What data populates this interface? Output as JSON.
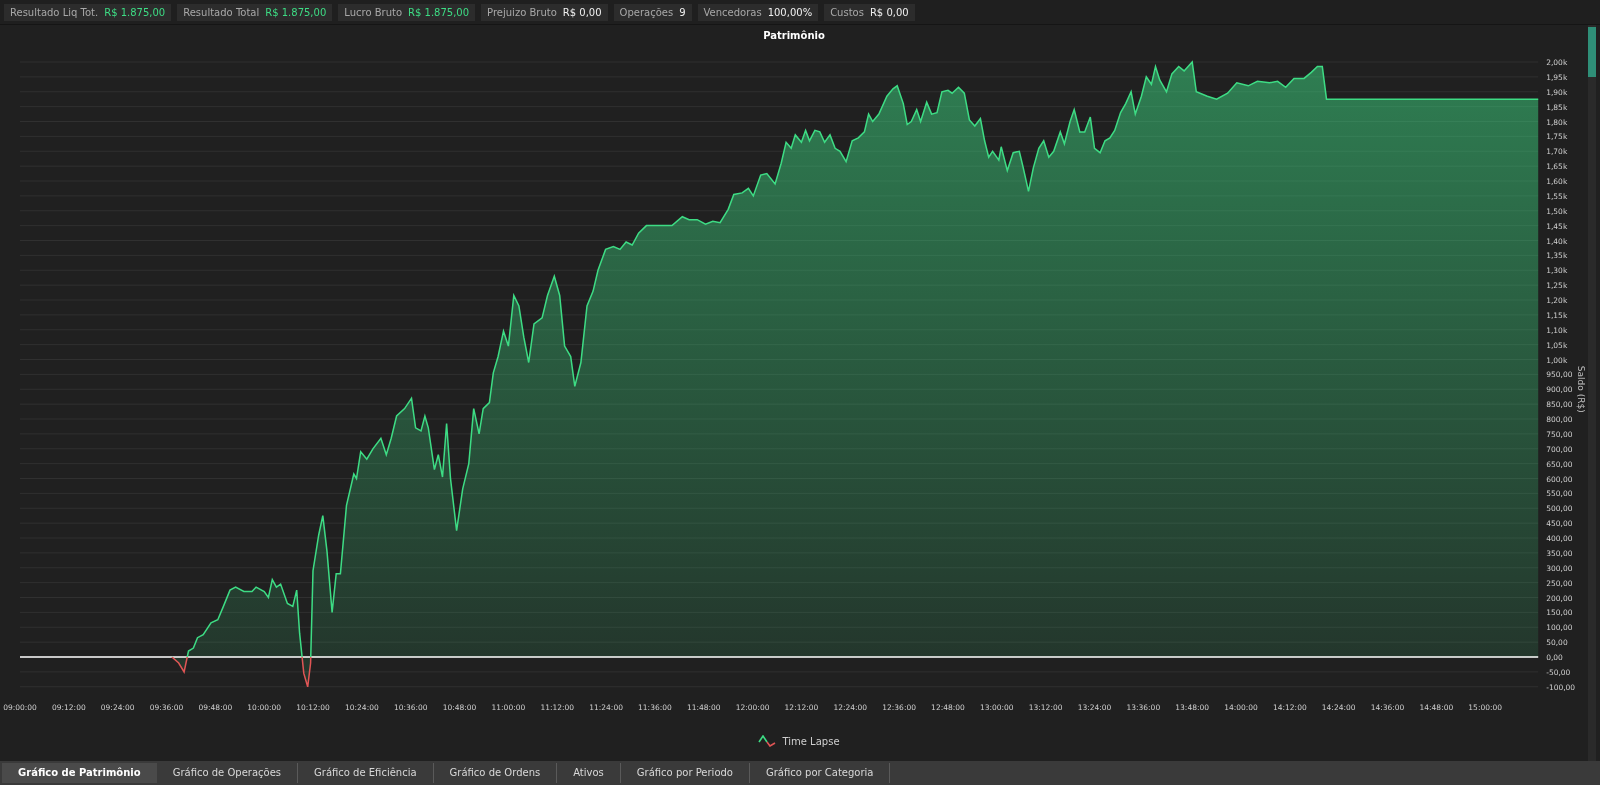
{
  "stats": [
    {
      "label": "Resultado Liq Tot.",
      "value": "R$ 1.875,00",
      "highlight": true
    },
    {
      "label": "Resultado Total",
      "value": "R$ 1.875,00",
      "highlight": true
    },
    {
      "label": "Lucro Bruto",
      "value": "R$ 1.875,00",
      "highlight": true
    },
    {
      "label": "Prejuizo Bruto",
      "value": "R$ 0,00",
      "highlight": false
    },
    {
      "label": "Operações",
      "value": "9",
      "highlight": false
    },
    {
      "label": "Vencedoras",
      "value": "100,00%",
      "highlight": false
    },
    {
      "label": "Custos",
      "value": "R$ 0,00",
      "highlight": false
    }
  ],
  "chart": {
    "chart_data": {
      "type": "area",
      "title": "Patrimônio",
      "ylabel": "Saldo (R$)",
      "x": [
        9.622,
        9.65,
        9.672,
        9.69,
        9.71,
        9.727,
        9.75,
        9.782,
        9.81,
        9.833,
        9.86,
        9.883,
        9.917,
        9.95,
        9.967,
        10,
        10.017,
        10.033,
        10.05,
        10.067,
        10.095,
        10.117,
        10.133,
        10.145,
        10.162,
        10.178,
        10.19,
        10.2,
        10.223,
        10.24,
        10.257,
        10.278,
        10.295,
        10.312,
        10.337,
        10.367,
        10.378,
        10.395,
        10.42,
        10.445,
        10.478,
        10.5,
        10.52,
        10.542,
        10.575,
        10.603,
        10.62,
        10.642,
        10.658,
        10.672,
        10.697,
        10.713,
        10.73,
        10.747,
        10.763,
        10.788,
        10.813,
        10.838,
        10.858,
        10.88,
        10.897,
        10.922,
        10.938,
        10.958,
        10.98,
        11,
        11.022,
        11.043,
        11.063,
        11.083,
        11.105,
        11.138,
        11.16,
        11.188,
        11.21,
        11.23,
        11.255,
        11.272,
        11.297,
        11.322,
        11.347,
        11.367,
        11.398,
        11.43,
        11.457,
        11.482,
        11.507,
        11.533,
        11.565,
        11.607,
        11.67,
        11.712,
        11.74,
        11.773,
        11.807,
        11.837,
        11.867,
        11.9,
        11.923,
        11.957,
        11.983,
        12.003,
        12.033,
        12.058,
        12.092,
        12.117,
        12.137,
        12.158,
        12.175,
        12.2,
        12.217,
        12.233,
        12.255,
        12.275,
        12.295,
        12.317,
        12.338,
        12.358,
        12.383,
        12.408,
        12.433,
        12.458,
        12.475,
        12.492,
        12.517,
        12.55,
        12.575,
        12.592,
        12.617,
        12.633,
        12.65,
        12.672,
        12.688,
        12.713,
        12.733,
        12.755,
        12.775,
        12.8,
        12.817,
        12.843,
        12.867,
        12.888,
        12.91,
        12.933,
        12.95,
        12.967,
        12.983,
        13.008,
        13.018,
        13.043,
        13.067,
        13.092,
        13.108,
        13.13,
        13.15,
        13.172,
        13.192,
        13.213,
        13.233,
        13.26,
        13.277,
        13.3,
        13.317,
        13.34,
        13.36,
        13.383,
        13.4,
        13.423,
        13.443,
        13.463,
        13.483,
        13.507,
        13.528,
        13.55,
        13.567,
        13.592,
        13.612,
        13.633,
        13.65,
        13.667,
        13.695,
        13.717,
        13.745,
        13.767,
        13.8,
        13.817,
        13.862,
        13.9,
        13.945,
        13.983,
        14.03,
        14.067,
        14.117,
        14.15,
        14.183,
        14.217,
        14.258,
        14.288,
        14.313,
        14.333,
        14.35,
        15.217
      ],
      "series": [
        {
          "name": "Time Lapse",
          "color": "#3ddc84",
          "values": [
            0,
            -20,
            -50,
            20,
            30,
            65,
            75,
            115,
            125,
            170,
            225,
            235,
            220,
            220,
            235,
            220,
            200,
            260,
            235,
            245,
            180,
            170,
            225,
            80,
            -55,
            -100,
            -20,
            290,
            410,
            475,
            355,
            150,
            280,
            280,
            510,
            615,
            600,
            690,
            665,
            700,
            735,
            680,
            735,
            810,
            835,
            870,
            770,
            760,
            810,
            770,
            630,
            680,
            605,
            785,
            600,
            425,
            565,
            650,
            835,
            750,
            835,
            855,
            955,
            1010,
            1095,
            1045,
            1215,
            1180,
            1075,
            990,
            1120,
            1140,
            1215,
            1280,
            1215,
            1045,
            1010,
            910,
            990,
            1180,
            1230,
            1300,
            1370,
            1380,
            1370,
            1395,
            1385,
            1425,
            1450,
            1450,
            1450,
            1480,
            1470,
            1470,
            1455,
            1465,
            1460,
            1505,
            1555,
            1560,
            1575,
            1550,
            1620,
            1625,
            1590,
            1660,
            1730,
            1710,
            1755,
            1730,
            1770,
            1735,
            1770,
            1765,
            1730,
            1755,
            1710,
            1700,
            1665,
            1735,
            1745,
            1765,
            1825,
            1800,
            1825,
            1885,
            1910,
            1920,
            1860,
            1790,
            1800,
            1840,
            1800,
            1865,
            1825,
            1830,
            1900,
            1905,
            1895,
            1915,
            1895,
            1805,
            1785,
            1810,
            1735,
            1680,
            1700,
            1670,
            1715,
            1635,
            1695,
            1700,
            1645,
            1565,
            1645,
            1710,
            1735,
            1680,
            1700,
            1765,
            1725,
            1800,
            1840,
            1765,
            1765,
            1815,
            1710,
            1695,
            1735,
            1745,
            1770,
            1830,
            1860,
            1900,
            1825,
            1885,
            1950,
            1925,
            1985,
            1940,
            1900,
            1960,
            1985,
            1970,
            2000,
            1900,
            1885,
            1875,
            1895,
            1930,
            1920,
            1935,
            1930,
            1935,
            1915,
            1945,
            1945,
            1965,
            1985,
            1985,
            1875,
            1875
          ]
        }
      ],
      "xlim": [
        9,
        15.217
      ],
      "ylim": [
        -100,
        2000
      ],
      "grid": true,
      "xticks": [
        {
          "value": 9,
          "label": "09:00:00"
        },
        {
          "value": 9.2,
          "label": "09:12:00"
        },
        {
          "value": 9.4,
          "label": "09:24:00"
        },
        {
          "value": 9.6,
          "label": "09:36:00"
        },
        {
          "value": 9.8,
          "label": "09:48:00"
        },
        {
          "value": 10,
          "label": "10:00:00"
        },
        {
          "value": 10.2,
          "label": "10:12:00"
        },
        {
          "value": 10.4,
          "label": "10:24:00"
        },
        {
          "value": 10.6,
          "label": "10:36:00"
        },
        {
          "value": 10.8,
          "label": "10:48:00"
        },
        {
          "value": 11,
          "label": "11:00:00"
        },
        {
          "value": 11.2,
          "label": "11:12:00"
        },
        {
          "value": 11.4,
          "label": "11:24:00"
        },
        {
          "value": 11.6,
          "label": "11:36:00"
        },
        {
          "value": 11.8,
          "label": "11:48:00"
        },
        {
          "value": 12,
          "label": "12:00:00"
        },
        {
          "value": 12.2,
          "label": "12:12:00"
        },
        {
          "value": 12.4,
          "label": "12:24:00"
        },
        {
          "value": 12.6,
          "label": "12:36:00"
        },
        {
          "value": 12.8,
          "label": "12:48:00"
        },
        {
          "value": 13,
          "label": "13:00:00"
        },
        {
          "value": 13.2,
          "label": "13:12:00"
        },
        {
          "value": 13.4,
          "label": "13:24:00"
        },
        {
          "value": 13.6,
          "label": "13:36:00"
        },
        {
          "value": 13.8,
          "label": "13:48:00"
        },
        {
          "value": 14,
          "label": "14:00:00"
        },
        {
          "value": 14.2,
          "label": "14:12:00"
        },
        {
          "value": 14.4,
          "label": "14:24:00"
        },
        {
          "value": 14.6,
          "label": "14:36:00"
        },
        {
          "value": 14.8,
          "label": "14:48:00"
        },
        {
          "value": 15,
          "label": "15:00:00"
        }
      ],
      "yticks": [
        {
          "value": 2000,
          "label": "2,00k"
        },
        {
          "value": 1950,
          "label": "1,95k"
        },
        {
          "value": 1900,
          "label": "1,90k"
        },
        {
          "value": 1850,
          "label": "1,85k"
        },
        {
          "value": 1800,
          "label": "1,80k"
        },
        {
          "value": 1750,
          "label": "1,75k"
        },
        {
          "value": 1700,
          "label": "1,70k"
        },
        {
          "value": 1650,
          "label": "1,65k"
        },
        {
          "value": 1600,
          "label": "1,60k"
        },
        {
          "value": 1550,
          "label": "1,55k"
        },
        {
          "value": 1500,
          "label": "1,50k"
        },
        {
          "value": 1450,
          "label": "1,45k"
        },
        {
          "value": 1400,
          "label": "1,40k"
        },
        {
          "value": 1350,
          "label": "1,35k"
        },
        {
          "value": 1300,
          "label": "1,30k"
        },
        {
          "value": 1250,
          "label": "1,25k"
        },
        {
          "value": 1200,
          "label": "1,20k"
        },
        {
          "value": 1150,
          "label": "1,15k"
        },
        {
          "value": 1100,
          "label": "1,10k"
        },
        {
          "value": 1050,
          "label": "1,05k"
        },
        {
          "value": 1000,
          "label": "1,00k"
        },
        {
          "value": 950,
          "label": "950,00"
        },
        {
          "value": 900,
          "label": "900,00"
        },
        {
          "value": 850,
          "label": "850,00"
        },
        {
          "value": 800,
          "label": "800,00"
        },
        {
          "value": 750,
          "label": "750,00"
        },
        {
          "value": 700,
          "label": "700,00"
        },
        {
          "value": 650,
          "label": "650,00"
        },
        {
          "value": 600,
          "label": "600,00"
        },
        {
          "value": 550,
          "label": "550,00"
        },
        {
          "value": 500,
          "label": "500,00"
        },
        {
          "value": 450,
          "label": "450,00"
        },
        {
          "value": 400,
          "label": "400,00"
        },
        {
          "value": 350,
          "label": "350,00"
        },
        {
          "value": 300,
          "label": "300,00"
        },
        {
          "value": 250,
          "label": "250,00"
        },
        {
          "value": 200,
          "label": "200,00"
        },
        {
          "value": 150,
          "label": "150,00"
        },
        {
          "value": 100,
          "label": "100,00"
        },
        {
          "value": 50,
          "label": "50,00"
        },
        {
          "value": 0,
          "label": "0,00"
        },
        {
          "value": -50,
          "label": "-50,00"
        },
        {
          "value": -100,
          "label": "-100,00"
        }
      ]
    }
  },
  "tabs": [
    {
      "label": "Gráfico de Patrimônio",
      "selected": true
    },
    {
      "label": "Gráfico de Operações",
      "selected": false
    },
    {
      "label": "Gráfico de Eficiência",
      "selected": false
    },
    {
      "label": "Gráfico de Ordens",
      "selected": false
    },
    {
      "label": "Ativos",
      "selected": false
    },
    {
      "label": "Gráfico por Periodo",
      "selected": false
    },
    {
      "label": "Gráfico por Categoria",
      "selected": false
    }
  ]
}
